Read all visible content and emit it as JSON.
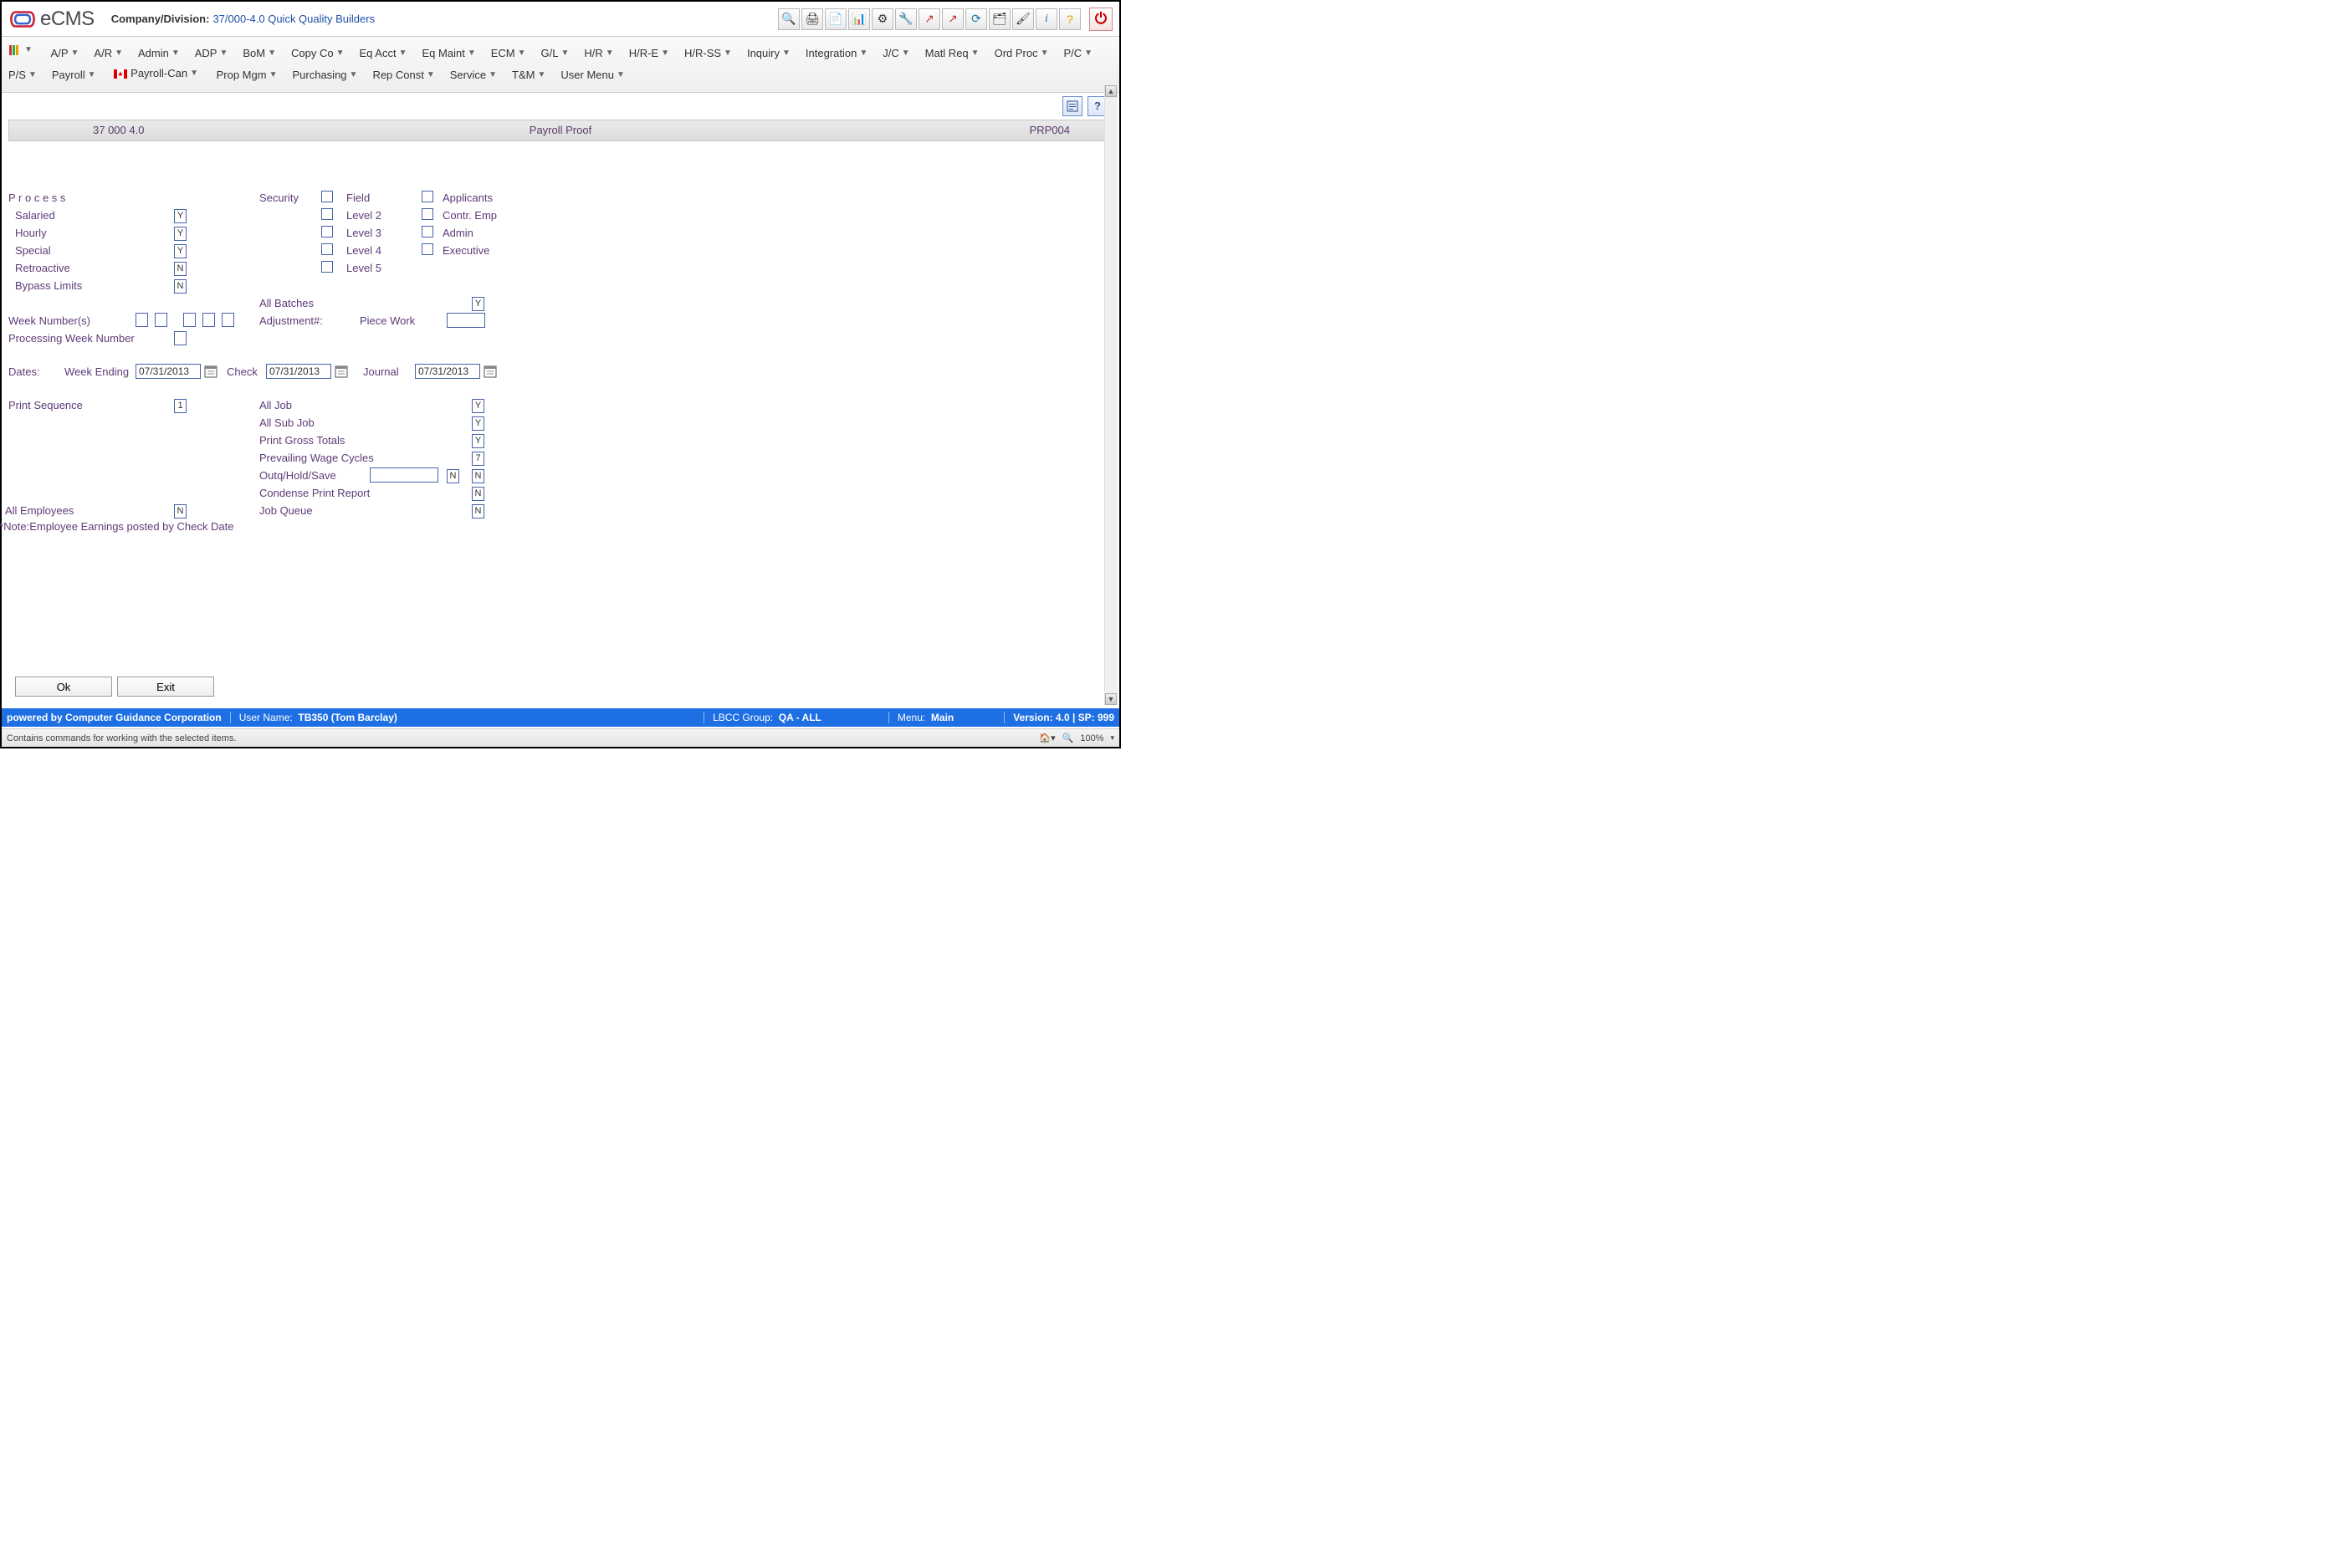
{
  "header": {
    "brand": "eCMS",
    "company_label": "Company/Division:",
    "company_value": "37/000-4.0 Quick Quality Builders"
  },
  "toolbar_icons": [
    "search",
    "print",
    "notes",
    "gantt",
    "gear",
    "wrench",
    "trend-up",
    "trend-down",
    "refresh",
    "files",
    "brush",
    "info",
    "help"
  ],
  "menu": {
    "row1": [
      "A/P",
      "A/R",
      "Admin",
      "ADP",
      "BoM",
      "Copy Co",
      "Eq Acct",
      "Eq Maint",
      "ECM",
      "G/L",
      "H/R",
      "H/R-E",
      "H/R-SS",
      "Inquiry",
      "Integration",
      "J/C",
      "Matl Req",
      "Ord Proc",
      "P/C"
    ],
    "row2_before_flag": [
      "P/S",
      "Payroll"
    ],
    "row2_flag_label": "Payroll-Can",
    "row2_after_flag": [
      "Prop Mgm",
      "Purchasing",
      "Rep Const",
      "Service",
      "T&M",
      "User Menu"
    ]
  },
  "breadcrumb": {
    "left": "37   000    4.0",
    "center": "Payroll Proof",
    "right": "PRP004"
  },
  "form": {
    "process_header": "P r o c e s s",
    "salaried": {
      "label": "Salaried",
      "value": "Y"
    },
    "hourly": {
      "label": "Hourly",
      "value": "Y"
    },
    "special": {
      "label": "Special",
      "value": "Y"
    },
    "retroactive": {
      "label": "Retroactive",
      "value": "N"
    },
    "bypass_limits": {
      "label": "Bypass Limits",
      "value": "N"
    },
    "security": "Security",
    "sec_cols_left": [
      "Field",
      "Level 2",
      "Level 3",
      "Level 4",
      "Level 5"
    ],
    "sec_cols_right": [
      "Applicants",
      "Contr. Emp",
      "Admin",
      "Executive"
    ],
    "all_batches": {
      "label": "All Batches",
      "value": "Y"
    },
    "adjustment": "Adjustment#:",
    "piece_work": "Piece Work",
    "week_numbers": "Week Number(s)",
    "processing_week": "Processing Week Number",
    "dates_label": "Dates:",
    "week_ending_label": "Week Ending",
    "week_ending_value": "07/31/2013",
    "check_label": "Check",
    "check_value": "07/31/2013",
    "journal_label": "Journal",
    "journal_value": "07/31/2013",
    "print_sequence": {
      "label": "Print Sequence",
      "value": "1"
    },
    "all_job": {
      "label": "All Job",
      "value": "Y"
    },
    "all_sub_job": {
      "label": "All Sub Job",
      "value": "Y"
    },
    "print_gross": {
      "label": "Print Gross Totals",
      "value": "Y"
    },
    "prevailing": {
      "label": "Prevailing Wage Cycles",
      "value": "7"
    },
    "outq": {
      "label": "Outq/Hold/Save",
      "box1": "N",
      "box2": "N"
    },
    "condense": {
      "label": "Condense Print Report",
      "value": "N"
    },
    "job_queue": {
      "label": "Job Queue",
      "value": "N"
    },
    "all_employees": {
      "label": "All Employees",
      "value": "N"
    },
    "note": "**Note:Employee Earnings posted by Check Date"
  },
  "buttons": {
    "ok": "Ok",
    "exit": "Exit"
  },
  "status": {
    "powered": "powered by Computer Guidance Corporation",
    "user_label": "User Name:",
    "user_value": "TB350 (Tom Barclay)",
    "lbcc_label": "LBCC Group:",
    "lbcc_value": "QA - ALL",
    "menu_label": "Menu:",
    "menu_value": "Main",
    "version": "Version: 4.0 | SP: 999"
  },
  "browser_status": {
    "left": "Contains commands for working with the selected items.",
    "zoom": "100%"
  }
}
